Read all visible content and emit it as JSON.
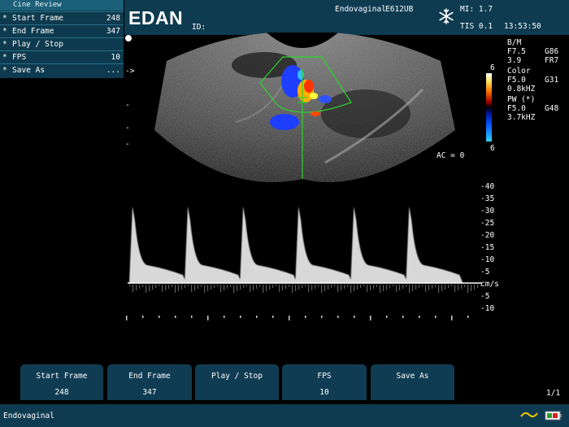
{
  "cine_menu": {
    "title": "Cine Review",
    "items": [
      {
        "star": "*",
        "label": "Start Frame",
        "value": "248"
      },
      {
        "star": "*",
        "label": "End Frame",
        "value": "347"
      },
      {
        "star": "*",
        "label": "Play / Stop",
        "value": ""
      },
      {
        "star": "*",
        "label": "FPS",
        "value": "10"
      },
      {
        "star": "*",
        "label": "Save As",
        "value": "..."
      }
    ]
  },
  "header": {
    "logo": "EDAN",
    "id_label": "ID:",
    "exam": "Endovaginal",
    "probe": "E612UB",
    "mi": "MI: 1.7",
    "tis": "TIS 0.1",
    "time": "13:53:50"
  },
  "params": {
    "bm_title": "B/M",
    "bm_freq": "F7.5",
    "bm_gain": "G86",
    "bm_depth": "3.9",
    "bm_fr": "FR7",
    "color_title": "Color",
    "color_freq": "F5.0",
    "color_gain": "G31",
    "color_prf": "0.8kHZ",
    "pw_title": "PW (*)",
    "pw_freq": "F5.0",
    "pw_gain": "G48",
    "pw_prf": "3.7kHZ"
  },
  "colorbar": {
    "top": "6",
    "bottom": "6"
  },
  "ac_label": "AC = 0",
  "spectrum": {
    "scale_labels": [
      "-40",
      "-35",
      "-30",
      "-25",
      "-20",
      "-15",
      "-10",
      "-5"
    ],
    "unit": "cm/s",
    "below_labels": [
      "-5",
      "-10"
    ],
    "ticks": [
      "-",
      "-",
      "-"
    ],
    "peak_times_s": [
      0.0,
      0.92,
      1.84,
      2.76,
      3.68,
      4.6
    ],
    "peak_velocity_cms": -32
  },
  "softkeys": [
    {
      "label": "Start Frame",
      "value": "248"
    },
    {
      "label": "End Frame",
      "value": "347"
    },
    {
      "label": "Play / Stop",
      "value": ""
    },
    {
      "label": "FPS",
      "value": "10"
    },
    {
      "label": "Save As",
      "value": ""
    }
  ],
  "page_indicator": "1/1",
  "status": {
    "exam": "Endovaginal"
  }
}
